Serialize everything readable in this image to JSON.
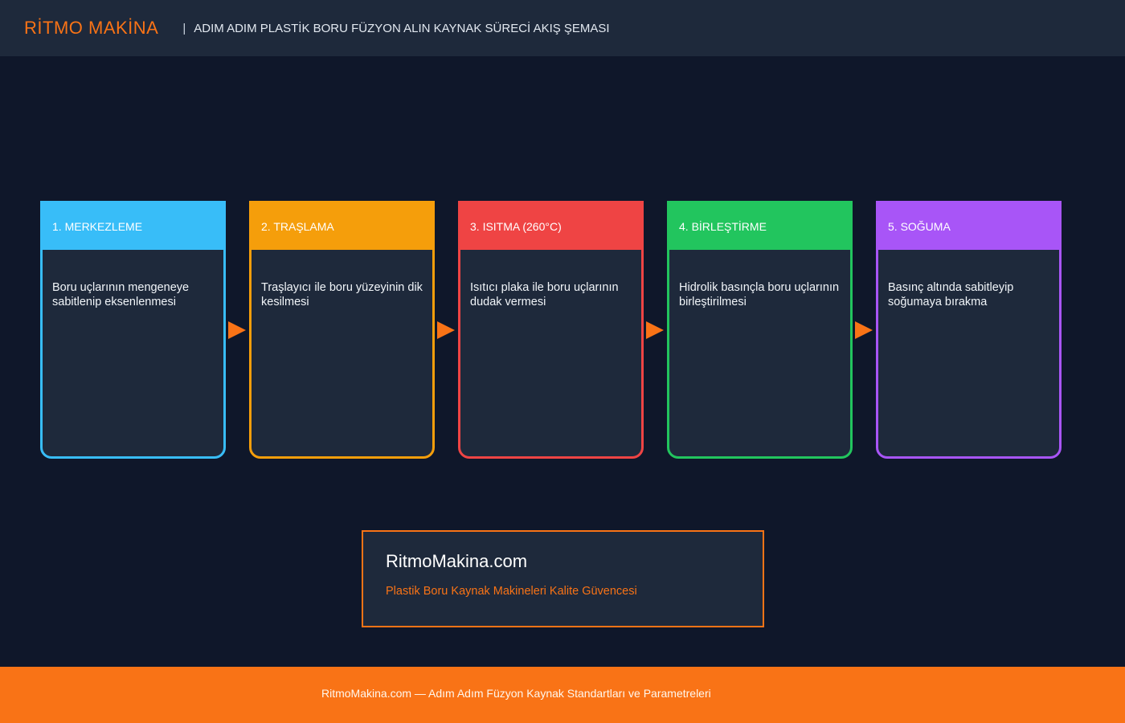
{
  "header": {
    "brand": "RİTMO MAKİNA",
    "separator": "|",
    "title": "ADIM ADIM PLASTİK BORU FÜZYON ALIN KAYNAK SÜRECİ AKIŞ ŞEMASI"
  },
  "steps": [
    {
      "title": "1. MERKEZLEME",
      "description": "Boru uçlarının mengeneye sabitlenip eksenlenmesi",
      "color": "#38bdf8"
    },
    {
      "title": "2. TRAŞLAMA",
      "description": "Traşlayıcı ile boru yüzeyinin dik kesilmesi",
      "color": "#f59e0b"
    },
    {
      "title": "3. ISITMA (260°C)",
      "description": "Isıtıcı plaka ile boru uçlarının dudak vermesi",
      "color": "#ef4444"
    },
    {
      "title": "4. BİRLEŞTİRME",
      "description": "Hidrolik basınçla boru uçlarının birleştirilmesi",
      "color": "#22c55e"
    },
    {
      "title": "5. SOĞUMA",
      "description": "Basınç altında sabitleyip soğumaya bırakma",
      "color": "#a855f7"
    }
  ],
  "arrow_color": "#f97316",
  "info_box": {
    "title": "RitmoMakina.com",
    "subtitle": "Plastik Boru Kaynak Makineleri Kalite Güvencesi"
  },
  "footer": {
    "text": "RitmoMakina.com — Adım Adım Füzyon Kaynak Standartları ve Parametreleri"
  }
}
